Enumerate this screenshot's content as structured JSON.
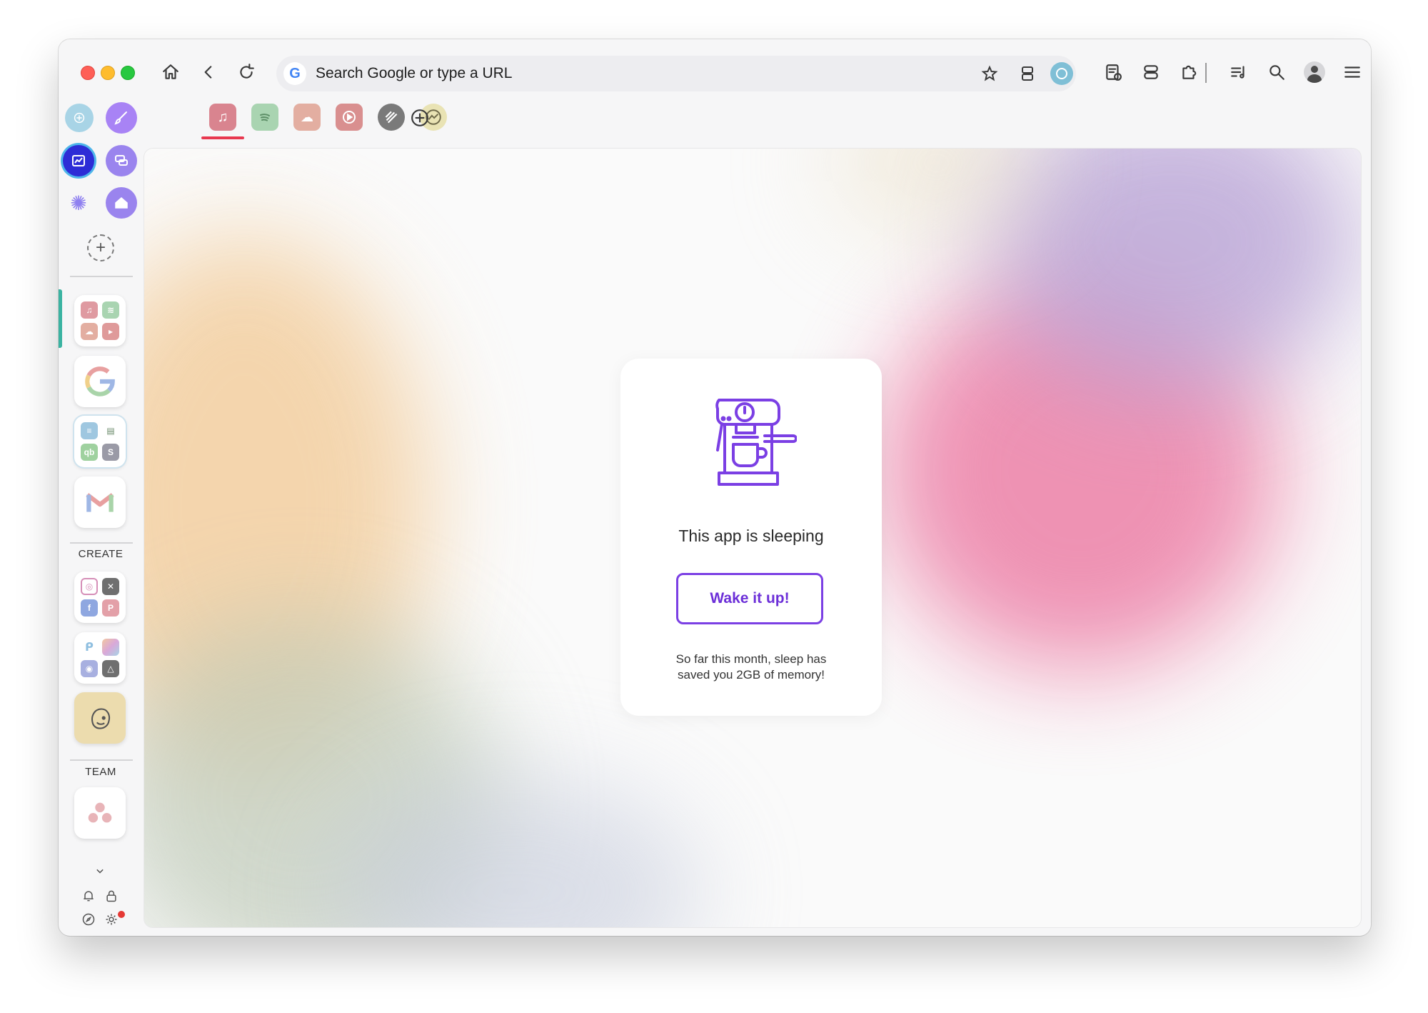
{
  "toolbar": {
    "search_placeholder": "Search Google or type a URL",
    "google_glyph": "G"
  },
  "sidebar": {
    "section_create": "CREATE",
    "section_team": "TEAM"
  },
  "sleep_card": {
    "title": "This app is sleeping",
    "button": "Wake it up!",
    "note_line1": "So far this month, sleep has",
    "note_line2": "saved you 2GB of memory!"
  },
  "colors": {
    "accent": "#7b3fe4",
    "active_tab_underline": "#e8384f",
    "sidebar_active": "#3ab3a1"
  }
}
